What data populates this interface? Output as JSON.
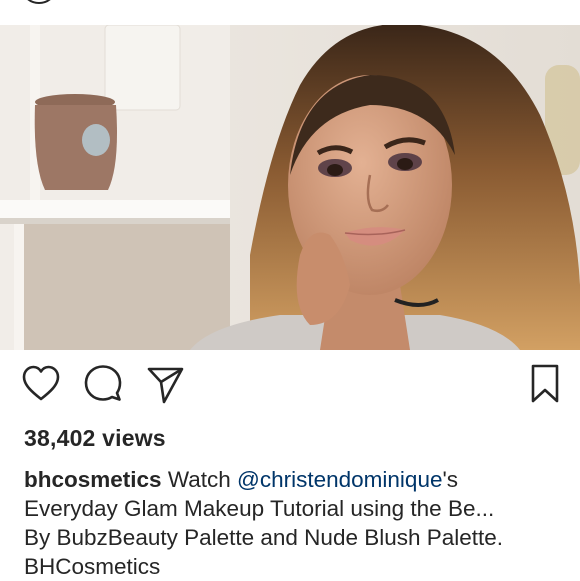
{
  "post": {
    "image_alt": "Woman with long wavy hair wearing makeup",
    "views": "38,402 views",
    "caption": {
      "username": "bhcosmetics",
      "text_before_mention": "Watch",
      "mention": "@christendominique",
      "text_after_mention": "'s",
      "line2": "Everyday Glam Makeup Tutorial using the Be...",
      "line3": "By BubzBeauty Palette and Nude Blush Palette.",
      "line4": "BHCosmetics"
    }
  },
  "icons": {
    "like": "heart-icon",
    "comment": "comment-bubble-icon",
    "share": "paper-plane-icon",
    "save": "bookmark-icon"
  },
  "colors": {
    "text": "#262626",
    "mention": "#003569",
    "background": "#ffffff"
  }
}
